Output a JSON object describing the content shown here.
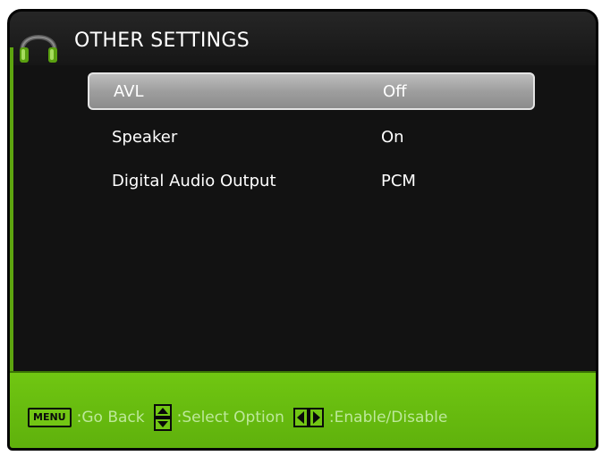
{
  "header": {
    "title": "OTHER SETTINGS",
    "icon": "headphones-icon"
  },
  "menu": {
    "items": [
      {
        "label": "AVL",
        "value": "Off",
        "selected": true
      },
      {
        "label": "Speaker",
        "value": "On",
        "selected": false
      },
      {
        "label": "Digital Audio Output",
        "value": "PCM",
        "selected": false
      }
    ]
  },
  "footer": {
    "menu_key": "MENU",
    "go_back": ":Go Back",
    "select_option": ":Select Option",
    "enable_disable": ":Enable/Disable"
  },
  "colors": {
    "accent_green": "#6cc012",
    "panel_bg": "#121212",
    "selection": "#a3a3a3"
  }
}
